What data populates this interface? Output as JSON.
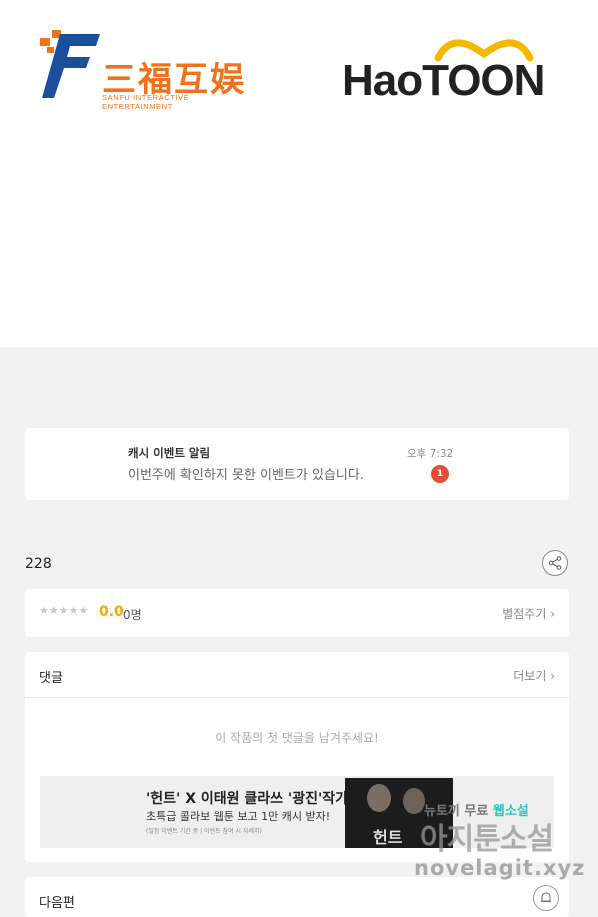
{
  "logos": {
    "sanfu_cn": "三福互娱",
    "sanfu_en": "SANFU INTERACTIVE ENTERTAINMENT",
    "haotoon": "HaoTOON"
  },
  "notification": {
    "title": "캐시 이벤트 알림",
    "body": "이번주에 확인하지 못한 이벤트가 있습니다.",
    "time": "오후 7:32",
    "badge": "1"
  },
  "episode": {
    "views": "228"
  },
  "rating": {
    "stars": "★★★★★",
    "score": "0.0",
    "count": "0명",
    "rate_link": "별점주기 ›"
  },
  "comments": {
    "title": "댓글",
    "more": "더보기 ›",
    "empty": "이 작품의 첫 댓글을 남겨주세요!"
  },
  "banner": {
    "title": "'헌트' X 이태원 클라쓰 '광진'작가",
    "subtitle": "초특급 콜라보 웹툰 보고 1만 캐시 받자!",
    "fine_print": "(일정 이벤트 기간 중 | 이벤트 참여 시 자세히)",
    "photo_text": "헌트"
  },
  "next": {
    "label": "다음편"
  },
  "watermark": {
    "line1_prefix": "뉴토끼 무료 ",
    "line1_accent": "웹소설",
    "line2": "아지툰소설",
    "line3": "novelagit.xyz"
  },
  "colors": {
    "sanfu_orange": "#f0731c",
    "sanfu_blue": "#1b4f9c",
    "badge_red": "#e64b36",
    "score_gold": "#f2a900"
  }
}
